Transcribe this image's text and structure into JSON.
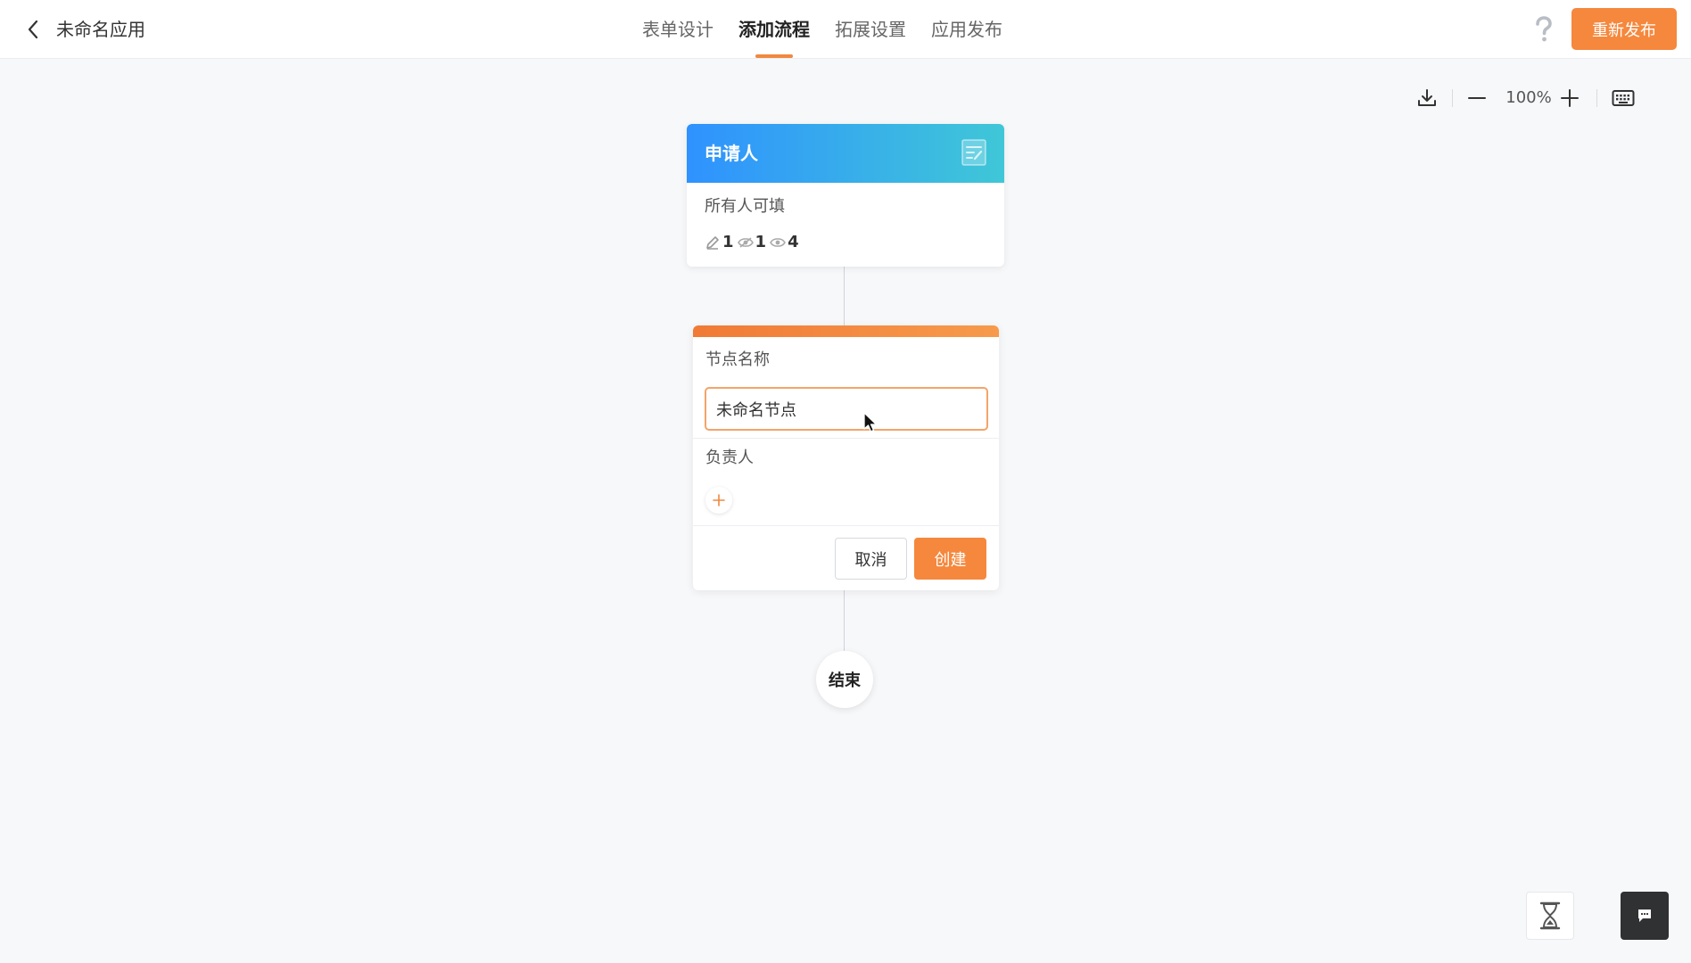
{
  "header": {
    "app_title": "未命名应用",
    "tabs": [
      {
        "label": "表单设计",
        "active": false
      },
      {
        "label": "添加流程",
        "active": true
      },
      {
        "label": "拓展设置",
        "active": false
      },
      {
        "label": "应用发布",
        "active": false
      }
    ],
    "republish_label": "重新发布",
    "accent_color": "#f5883d"
  },
  "toolbar": {
    "zoom_level": "100%",
    "icons": [
      "download-icon",
      "zoom-out-icon",
      "zoom-in-icon",
      "keyboard-icon"
    ]
  },
  "flow": {
    "applicant": {
      "title": "申请人",
      "subtitle": "所有人可填",
      "permissions": {
        "editable": "1",
        "hidden": "1",
        "readonly": "4"
      }
    },
    "node_editor": {
      "name_label": "节点名称",
      "name_value": "未命名节点",
      "owner_label": "负责人",
      "cancel_label": "取消",
      "create_label": "创建"
    },
    "end_label": "结束"
  }
}
